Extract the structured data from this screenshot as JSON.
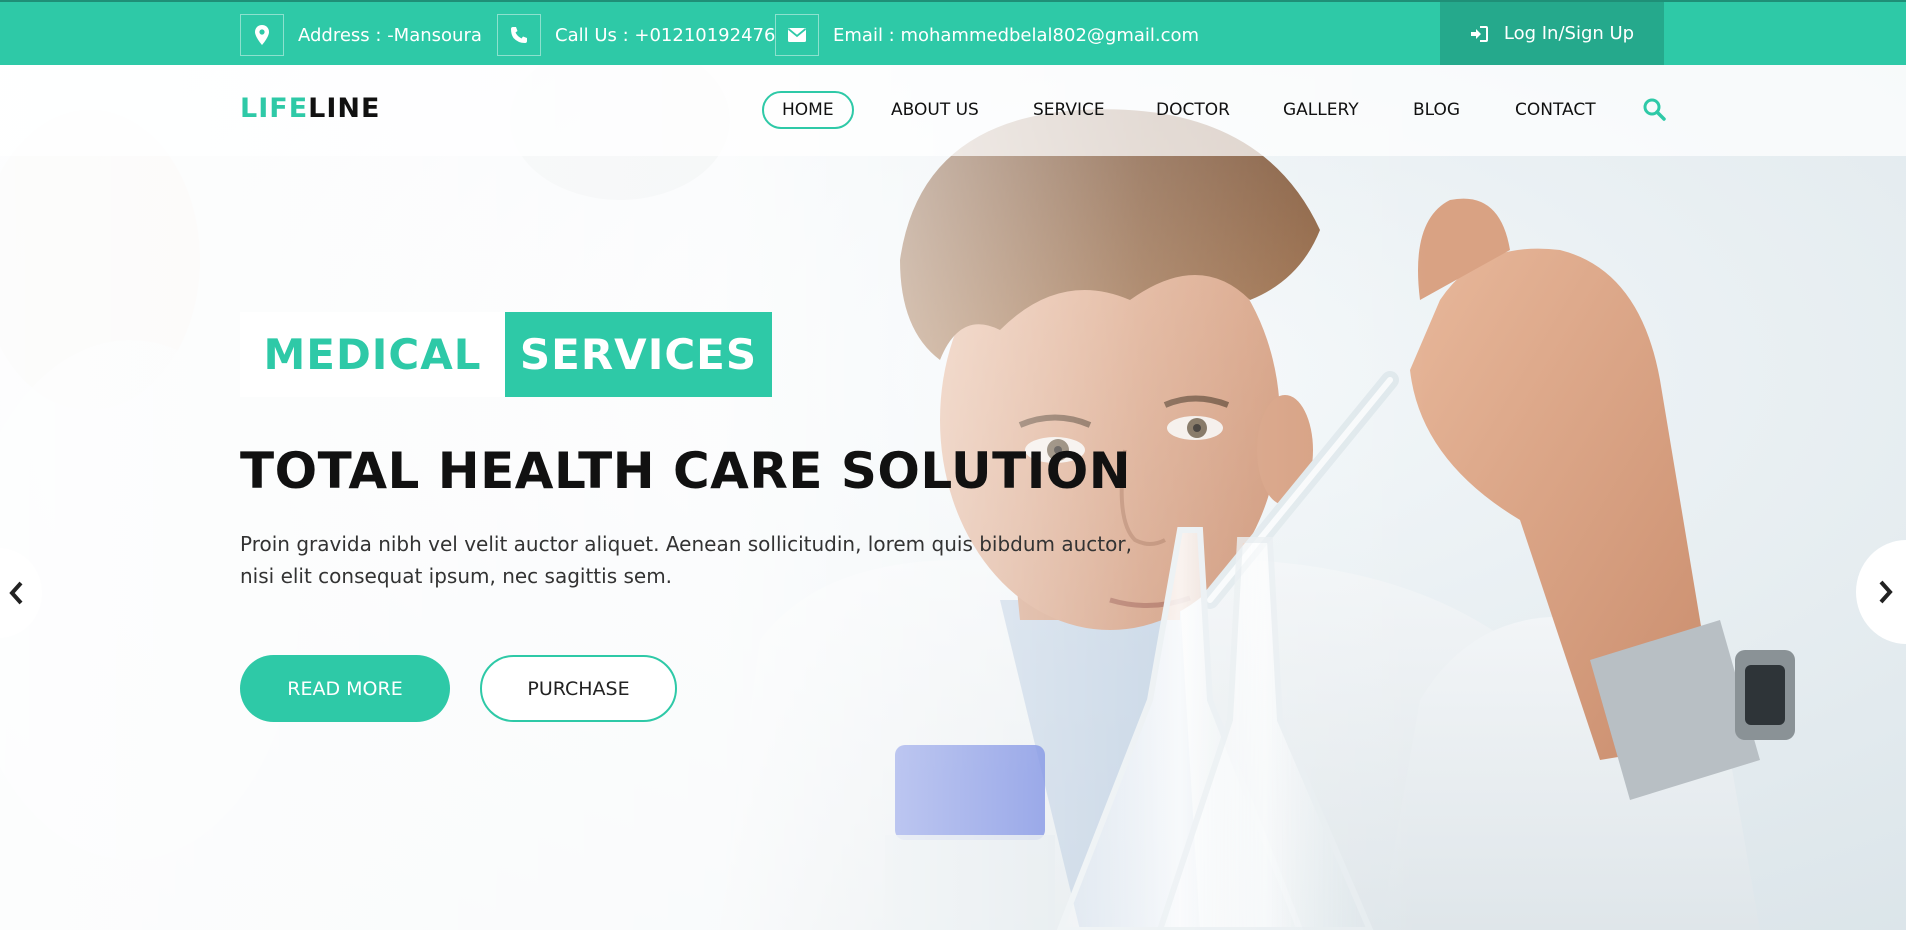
{
  "topbar": {
    "address": "Address : -Mansoura",
    "phone": "Call Us : +01210192476",
    "email": "Email : mohammedbelal802@gmail.com",
    "login_label": "Log In/Sign Up"
  },
  "navbar": {
    "logo_part1": "LIFE",
    "logo_part2": "LINE",
    "items": [
      {
        "label": "HOME",
        "active": true
      },
      {
        "label": "ABOUT US"
      },
      {
        "label": "SERVICE"
      },
      {
        "label": "DOCTOR"
      },
      {
        "label": "GALLERY"
      },
      {
        "label": "BLOG"
      },
      {
        "label": "CONTACT"
      }
    ]
  },
  "hero": {
    "tag_word1": "MEDICAL",
    "tag_word2": "SERVICES",
    "headline": "TOTAL HEALTH CARE SOLUTION",
    "subtext_line1": "Proin gravida nibh vel velit auctor aliquet. Aenean sollicitudin, lorem quis bibdum auctor,",
    "subtext_line2": "nisi elit consequat ipsum, nec sagittis sem.",
    "primary_button": "READ MORE",
    "secondary_button": "PURCHASE"
  },
  "colors": {
    "brand": "#2ec9a7",
    "brand_dark": "#25a98c"
  },
  "icons": {
    "address": "map-marker-icon",
    "phone": "phone-icon",
    "email": "envelope-icon",
    "login": "sign-in-icon",
    "search": "search-icon",
    "prev": "chevron-left-icon",
    "next": "chevron-right-icon"
  }
}
